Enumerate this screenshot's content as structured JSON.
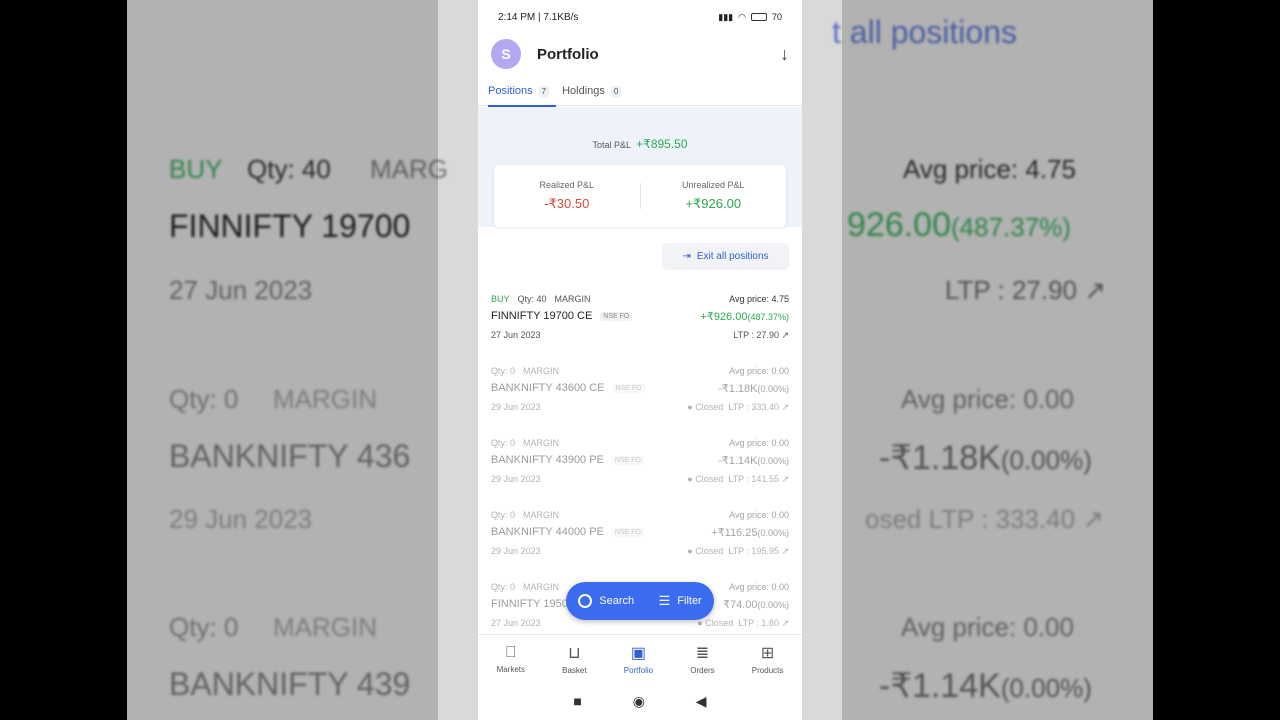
{
  "background_zoom": {
    "top_right": "t all positions",
    "buy": "BUY",
    "qty": "Qty: 40",
    "margin": "MARG",
    "avg": "Avg price: 4.75",
    "contract": "FINNIFTY 19700",
    "pnl": "926.00",
    "pnl_pct": "(487.37%)",
    "date": "27 Jun 2023",
    "ltp": "LTP : 27.90 ↗",
    "qty0": "Qty: 0",
    "margin2": "MARGIN",
    "avg0": "Avg price: 0.00",
    "contract2": "BANKNIFTY 436",
    "pnl2": "-₹1.18K",
    "pnl2_pct": "(0.00%)",
    "date2": "29 Jun 2023",
    "ltp2": "osed   LTP : 333.40 ↗",
    "qty0b": "Qty: 0",
    "margin3": "MARGIN",
    "avg0b": "Avg price: 0.00",
    "contract3": "BANKNIFTY 439",
    "pnl3": "-₹1.14K",
    "pnl3_pct": "(0.00%)"
  },
  "status_bar": {
    "left": "2:14 PM | 7.1KB/s",
    "right": "70"
  },
  "app": {
    "avatar_letter": "S",
    "title": "Portfolio"
  },
  "tabs": [
    {
      "label": "Positions",
      "count": "7"
    },
    {
      "label": "Holdings",
      "count": "0"
    }
  ],
  "summary": {
    "total_label": "Total P&L",
    "total_value": "+₹895.50",
    "realized_label": "Realized P&L",
    "realized_value": "-₹30.50",
    "unrealized_label": "Unrealized P&L",
    "unrealized_value": "+₹926.00"
  },
  "exit_all_label": "Exit all positions",
  "positions": [
    {
      "side": "BUY",
      "qty": "Qty: 40",
      "product": "MARGIN",
      "avg": "Avg price: 4.75",
      "name": "FINNIFTY 19700 CE",
      "exchange": "NSE FO",
      "pnl": "+₹926.00",
      "pct": "(487.37%)",
      "date": "27 Jun 2023",
      "status": "",
      "ltp": "LTP : 27.90 ↗"
    },
    {
      "side": "",
      "qty": "Qty: 0",
      "product": "MARGIN",
      "avg": "Avg price: 0.00",
      "name": "BANKNIFTY 43600 CE",
      "exchange": "NSE FO",
      "pnl": "-₹1.18K",
      "pct": "(0.00%)",
      "date": "29 Jun 2023",
      "status": "● Closed",
      "ltp": "LTP : 333.40 ↗"
    },
    {
      "side": "",
      "qty": "Qty: 0",
      "product": "MARGIN",
      "avg": "Avg price: 0.00",
      "name": "BANKNIFTY 43900 PE",
      "exchange": "NSE FO",
      "pnl": "-₹1.14K",
      "pct": "(0.00%)",
      "date": "29 Jun 2023",
      "status": "● Closed",
      "ltp": "LTP : 141.55 ↗"
    },
    {
      "side": "",
      "qty": "Qty: 0",
      "product": "MARGIN",
      "avg": "Avg price: 0.00",
      "name": "BANKNIFTY 44000 PE",
      "exchange": "NSE FO",
      "pnl": "+₹116.25",
      "pct": "(0.00%)",
      "date": "29 Jun 2023",
      "status": "● Closed",
      "ltp": "LTP : 195.95 ↗"
    },
    {
      "side": "",
      "qty": "Qty: 0",
      "product": "MARGIN",
      "avg": "Avg price: 0.00",
      "name": "FINNIFTY 1950",
      "exchange": "",
      "pnl": "₹74.00",
      "pct": "(0.00%)",
      "date": "27 Jun 2023",
      "status": "● Closed",
      "ltp": "LTP : 1.80 ↗"
    }
  ],
  "fab": {
    "search": "Search",
    "filter": "Filter"
  },
  "bottom_nav": [
    {
      "label": "Markets",
      "icon": "bookmark-icon"
    },
    {
      "label": "Basket",
      "icon": "basket-icon"
    },
    {
      "label": "Portfolio",
      "icon": "briefcase-icon"
    },
    {
      "label": "Orders",
      "icon": "orders-icon"
    },
    {
      "label": "Products",
      "icon": "grid-icon"
    }
  ],
  "colors": {
    "accent": "#2f5fd0",
    "positive": "#2ea84f",
    "negative": "#d34b3b",
    "fab": "#3b6cf0"
  }
}
